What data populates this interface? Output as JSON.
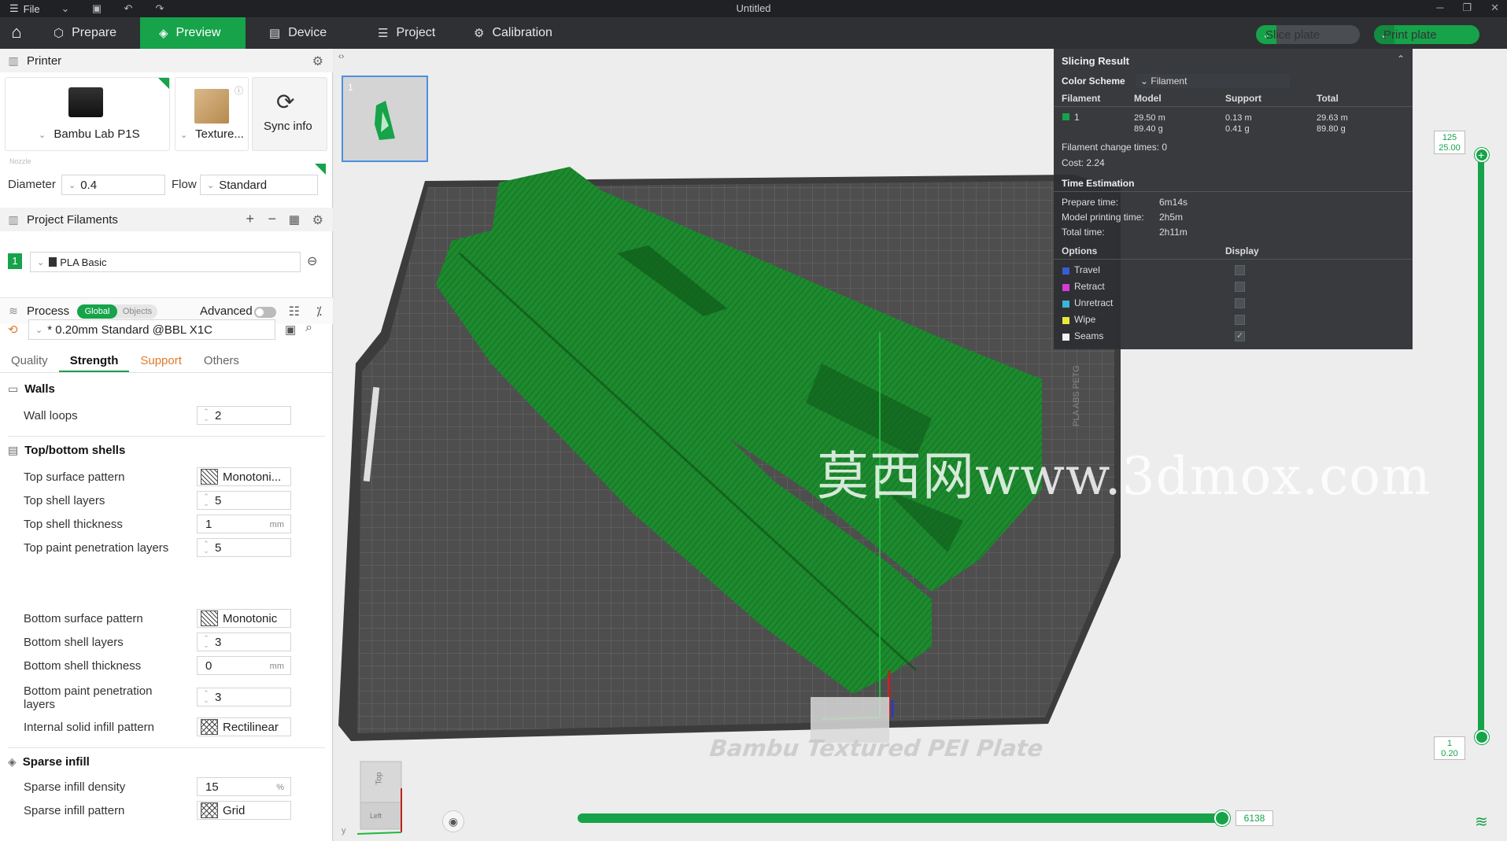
{
  "titlebar": {
    "file_label": "File",
    "title": "Untitled"
  },
  "toolbar": {
    "tabs": [
      {
        "label": "Prepare",
        "icon": "cube-icon"
      },
      {
        "label": "Preview",
        "icon": "layers-icon"
      },
      {
        "label": "Device",
        "icon": "device-icon"
      },
      {
        "label": "Project",
        "icon": "project-icon"
      },
      {
        "label": "Calibration",
        "icon": "calibration-icon"
      }
    ],
    "active_tab": "Preview",
    "slice_label": "Slice plate",
    "print_label": "Print plate",
    "accent": "#16a34a"
  },
  "printer": {
    "section_title": "Printer",
    "printer_name": "Bambu Lab P1S",
    "plate_name": "Texture...",
    "sync_label": "Sync info",
    "nozzle_label": "Nozzle",
    "diameter_label": "Diameter",
    "diameter_value": "0.4",
    "flow_label": "Flow",
    "flow_value": "Standard"
  },
  "filaments": {
    "section_title": "Project Filaments",
    "items": [
      {
        "index": "1",
        "name": "PLA Basic",
        "color": "#16a34a"
      }
    ]
  },
  "process": {
    "section_title": "Process",
    "toggle_global": "Global",
    "toggle_objects": "Objects",
    "advanced_label": "Advanced",
    "preset": "* 0.20mm Standard @BBL X1C",
    "tabs": [
      "Quality",
      "Strength",
      "Support",
      "Others"
    ],
    "active_tab": "Strength",
    "groups": {
      "walls": {
        "title": "Walls",
        "rows": [
          {
            "label": "Wall loops",
            "value": "2"
          }
        ]
      },
      "shells": {
        "title": "Top/bottom shells",
        "rows": [
          {
            "label": "Top surface pattern",
            "value": "Monotoni..."
          },
          {
            "label": "Top shell layers",
            "value": "5"
          },
          {
            "label": "Top shell thickness",
            "value": "1",
            "unit": "mm"
          },
          {
            "label": "Top paint penetration layers",
            "value": "5"
          },
          {
            "label": "Bottom surface pattern",
            "value": "Monotonic"
          },
          {
            "label": "Bottom shell layers",
            "value": "3"
          },
          {
            "label": "Bottom shell thickness",
            "value": "0",
            "unit": "mm"
          },
          {
            "label": "Bottom paint penetration layers",
            "value": "3"
          },
          {
            "label": "Internal solid infill pattern",
            "value": "Rectilinear"
          }
        ]
      },
      "infill": {
        "title": "Sparse infill",
        "rows": [
          {
            "label": "Sparse infill density",
            "value": "15",
            "unit": "%"
          },
          {
            "label": "Sparse infill pattern",
            "value": "Grid"
          }
        ]
      }
    }
  },
  "viewport": {
    "plate_number": "1",
    "watermark": "莫西网www.3dmox.com",
    "plate_label": "Bambu Textured PEI Plate",
    "plate_side_text": "PLA ABS PETG",
    "cube_top": "Top",
    "cube_left": "Left",
    "axis_y": "y",
    "layer_top": "125",
    "layer_top_height": "25.00",
    "layer_bottom": "1",
    "layer_bottom_height": "0.20",
    "move_value": "6138"
  },
  "slicing_result": {
    "title": "Slicing Result",
    "color_scheme_label": "Color Scheme",
    "color_scheme_value": "Filament",
    "headers": [
      "Filament",
      "Model",
      "Support",
      "Total"
    ],
    "row": {
      "filament": "1",
      "model_m": "29.50 m",
      "model_g": "89.40 g",
      "support_m": "0.13 m",
      "support_g": "0.41 g",
      "total_m": "29.63 m",
      "total_g": "89.80 g"
    },
    "filament_change": "Filament change times:  0",
    "cost": "Cost:  2.24",
    "time_title": "Time Estimation",
    "times": [
      {
        "label": "Prepare time:",
        "value": "6m14s"
      },
      {
        "label": "Model printing time:",
        "value": "2h5m"
      },
      {
        "label": "Total time:",
        "value": "2h11m"
      }
    ],
    "options_label": "Options",
    "display_label": "Display",
    "options": [
      {
        "label": "Travel",
        "color": "#3b5bd6",
        "checked": false
      },
      {
        "label": "Retract",
        "color": "#d63bd6",
        "checked": false
      },
      {
        "label": "Unretract",
        "color": "#3bb6d6",
        "checked": false
      },
      {
        "label": "Wipe",
        "color": "#e8e83b",
        "checked": false
      },
      {
        "label": "Seams",
        "color": "#f2f2f2",
        "checked": true
      }
    ]
  }
}
